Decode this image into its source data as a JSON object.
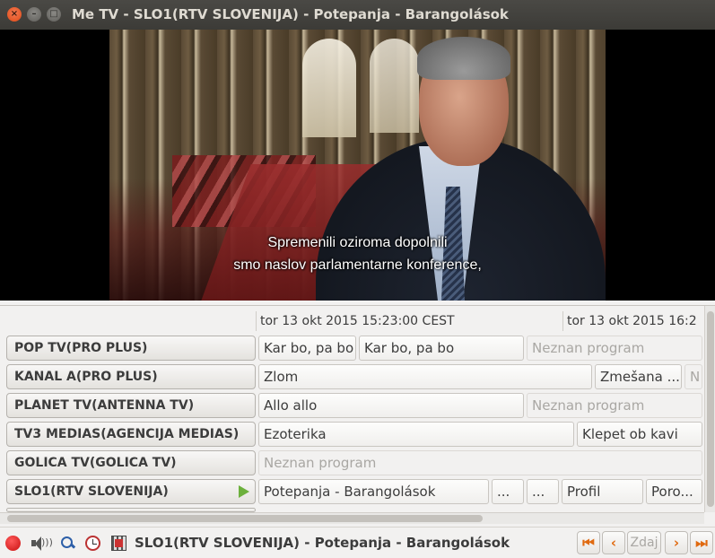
{
  "window": {
    "title": "Me TV - SLO1(RTV SLOVENIJA) - Potepanja - Barangolások",
    "close_glyph": "×",
    "minimize_glyph": "–",
    "maximize_glyph": "□"
  },
  "video": {
    "subtitle_line1": "Spremenili oziroma dopolnili",
    "subtitle_line2": "smo naslov parlamentarne konference,"
  },
  "epg": {
    "timeslots": [
      "tor 13 okt 2015 15:23:00 CEST",
      "tor 13 okt 2015 16:2"
    ],
    "channels": [
      {
        "name": "POP TV(PRO PLUS)",
        "programs": [
          "Kar bo, pa bo",
          "Kar bo, pa bo",
          "Neznan program"
        ]
      },
      {
        "name": "KANAL A(PRO PLUS)",
        "programs": [
          "Zlom",
          "Zmešana ...",
          "N"
        ]
      },
      {
        "name": "PLANET TV(ANTENNA TV)",
        "programs": [
          "Allo allo",
          "Neznan program"
        ]
      },
      {
        "name": "TV3 MEDIAS(AGENCIJA MEDIAS)",
        "programs": [
          "Ezoterika",
          "Klepet ob kavi"
        ]
      },
      {
        "name": "GOLICA TV(GOLICA TV)",
        "programs": [
          "Neznan program"
        ]
      },
      {
        "name": "SLO1(RTV SLOVENIJA)",
        "programs": [
          "Potepanja - Barangolások",
          "...",
          "...",
          "Profil",
          "Poro..."
        ]
      }
    ]
  },
  "status": {
    "now_playing": "SLO1(RTV SLOVENIJA) - Potepanja - Barangolások",
    "nav": {
      "first": "⏮",
      "prev": "‹",
      "now": "Zdaj",
      "next": "›",
      "last": "⏭"
    }
  },
  "colors": {
    "accent": "#e06a10",
    "record": "#d01818",
    "playing": "#6cb03c"
  }
}
